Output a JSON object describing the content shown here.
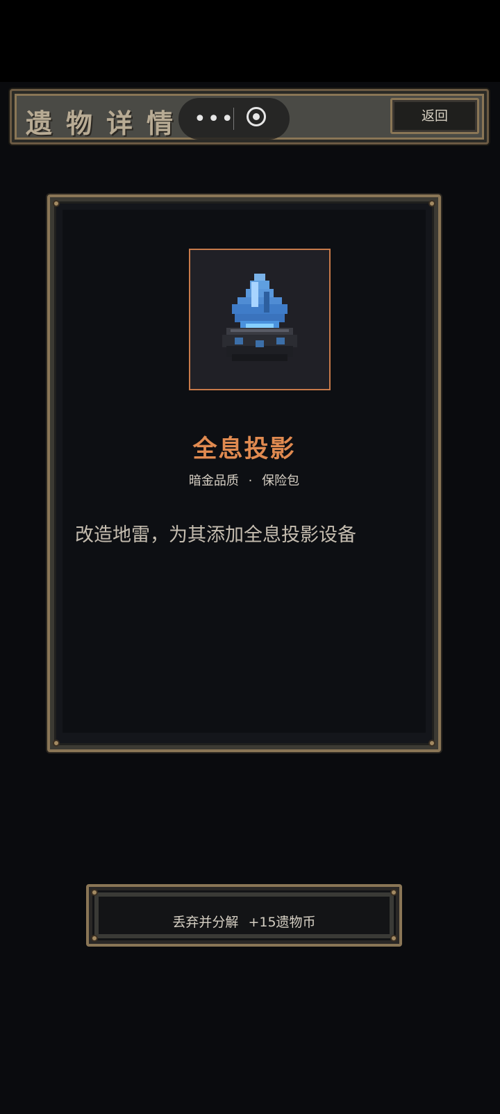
{
  "header": {
    "title": "遗物详情",
    "back_label": "返回"
  },
  "capsule": {
    "more_glyph": "•••"
  },
  "relic": {
    "name": "全息投影",
    "quality": "暗金品质",
    "separator": "·",
    "slot": "保险包",
    "description": "改造地雷，为其添加全息投影设备",
    "icon": "hologram-projector-icon"
  },
  "actions": {
    "discard_label": "丢弃并分解  +15遗物币"
  },
  "colors": {
    "name_accent": "#e08a50",
    "frame_gold": "#8a7656",
    "background": "#0a0b0e"
  }
}
